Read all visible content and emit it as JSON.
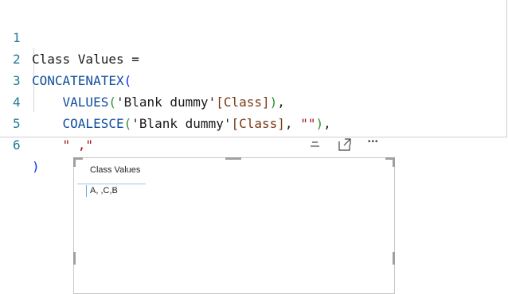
{
  "editor": {
    "lines": [
      {
        "n": "1"
      },
      {
        "n": "2"
      },
      {
        "n": "3"
      },
      {
        "n": "4"
      },
      {
        "n": "5"
      },
      {
        "n": "6"
      }
    ],
    "tokens": {
      "l1_measure": "Class Values =",
      "l2_fn": "CONCATENATEX",
      "l2_paren": "(",
      "l3_fn": "VALUES",
      "l3_open": "(",
      "l3_table": "'Blank dummy'",
      "l3_col": "[Class]",
      "l3_close": ")",
      "l3_comma": ",",
      "l4_fn": "COALESCE",
      "l4_open": "(",
      "l4_table": "'Blank dummy'",
      "l4_col": "[Class]",
      "l4_sep": ",",
      "l4_str": "\"\"",
      "l4_close": ")",
      "l4_comma": ",",
      "l5_str": "\" ,\"",
      "l6_close": ")"
    }
  },
  "visual_header": {
    "icons": [
      "filter-icon",
      "focus-mode-icon",
      "more-options-icon"
    ],
    "more_glyph": "•••"
  },
  "table_visual": {
    "column_header": "Class Values",
    "cell_value": "A, ,C,B"
  },
  "colors": {
    "line_number": "#237893",
    "function": "#0f4c9c",
    "string": "#a31515",
    "selection_accent": "#6ea6dc"
  }
}
